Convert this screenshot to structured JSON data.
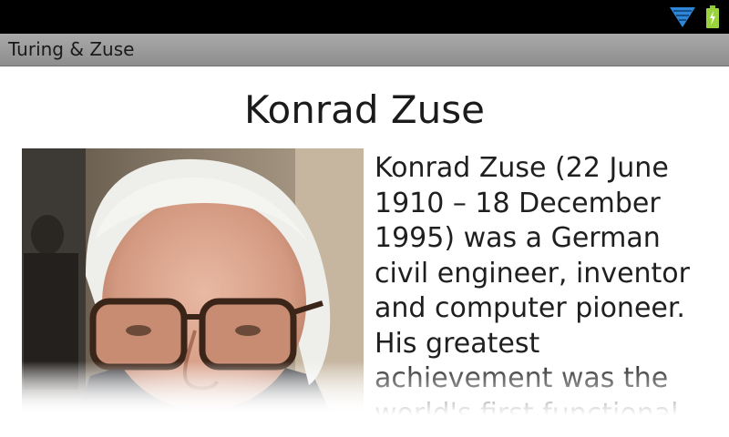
{
  "status_bar": {
    "icons": [
      "wifi-icon",
      "battery-charging-icon"
    ],
    "accent_color": "#3a8fd8",
    "battery_color": "#9bd33c"
  },
  "app": {
    "title": "Turing & Zuse"
  },
  "article": {
    "heading": "Konrad Zuse",
    "portrait_alt": "Photograph of Konrad Zuse",
    "bio": "Konrad Zuse (22 June\n1910 – 18 December\n1995) was a German\ncivil engineer, inventor\nand computer pioneer.\nHis greatest\nachievement was the\nworld's first functional"
  }
}
